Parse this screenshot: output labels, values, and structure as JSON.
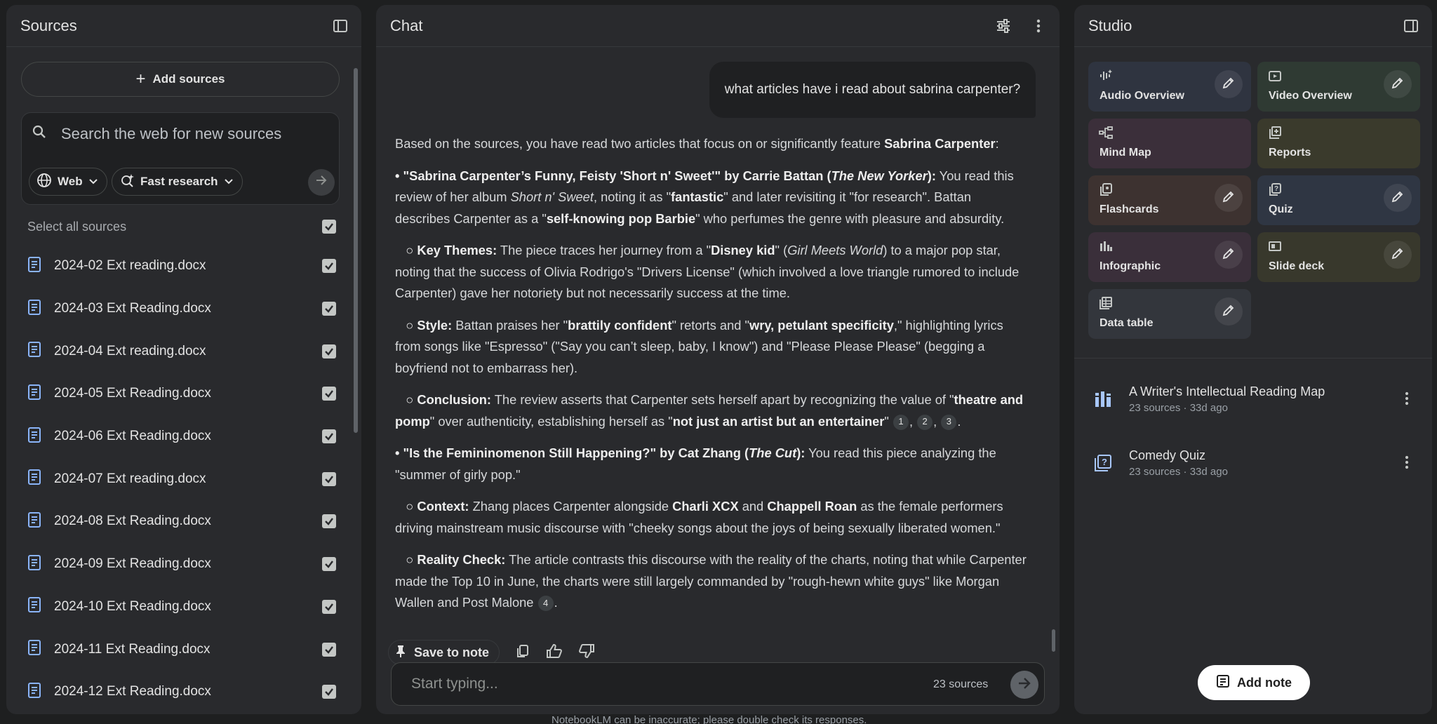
{
  "sources": {
    "title": "Sources",
    "add_sources_label": "Add sources",
    "search_placeholder": "Search the web for new sources",
    "web_chip": "Web",
    "research_chip": "Fast research",
    "select_all_label": "Select all sources",
    "items": [
      {
        "name": "2024-02 Ext reading.docx"
      },
      {
        "name": "2024-03 Ext Reading.docx"
      },
      {
        "name": "2024-04 Ext reading.docx"
      },
      {
        "name": "2024-05 Ext Reading.docx"
      },
      {
        "name": "2024-06 Ext Reading.docx"
      },
      {
        "name": "2024-07 Ext reading.docx"
      },
      {
        "name": "2024-08 Ext Reading.docx"
      },
      {
        "name": "2024-09 Ext Reading.docx"
      },
      {
        "name": "2024-10 Ext Reading.docx"
      },
      {
        "name": "2024-11 Ext Reading.docx"
      },
      {
        "name": "2024-12 Ext Reading.docx"
      }
    ]
  },
  "chat": {
    "title": "Chat",
    "user_message": "what articles have i read about sabrina carpenter?",
    "response": {
      "intro_a": "Based on the sources, you have read two articles that focus on or significantly feature ",
      "intro_b": "Sabrina Carpenter",
      "intro_c": ":",
      "a1_title": "• \"Sabrina Carpenter’s Funny, Feisty 'Short n' Sweet'\" by Carrie Battan (",
      "a1_pub": "The New Yorker",
      "a1_close": "):",
      "a1_t1": " You read this review of her album ",
      "a1_album": "Short n' Sweet",
      "a1_t2": ", noting it as \"",
      "a1_fantastic": "fantastic",
      "a1_t3": "\" and later revisiting it \"for research\". Battan describes Carpenter as a \"",
      "a1_barbie": "self-knowing pop Barbie",
      "a1_t4": "\" who perfumes the genre with pleasure and absurdity.",
      "kt_label": "○ Key Themes:",
      "kt_t1": " The piece traces her journey from a \"",
      "kt_disney": "Disney kid",
      "kt_t2": "\" (",
      "kt_gmw": "Girl Meets World",
      "kt_t3": ") to a major pop star, noting that the success of Olivia Rodrigo's \"Drivers License\" (which involved a love triangle rumored to include Carpenter) gave her notoriety but not necessarily success at the time.",
      "st_label": "○ Style:",
      "st_t1": " Battan praises her \"",
      "st_b1": "brattily confident",
      "st_t2": "\" retorts and \"",
      "st_b2": "wry, petulant specificity",
      "st_t3": ",\" highlighting lyrics from songs like \"Espresso\" (\"Say you can’t sleep, baby, I know\") and \"Please Please Please\" (begging a boyfriend not to embarrass her).",
      "co_label": "○ Conclusion:",
      "co_t1": " The review asserts that Carpenter sets herself apart by recognizing the value of \"",
      "co_b1": "theatre and pomp",
      "co_t2": "\" over authenticity, establishing herself as \"",
      "co_b2": "not just an artist but an entertainer",
      "co_t3": "\"",
      "cites_a": [
        "1",
        "2",
        "3"
      ],
      "a2_title": "• \"Is the Femininomenon Still Happening?\" by Cat Zhang (",
      "a2_pub": "The Cut",
      "a2_close": "):",
      "a2_t1": " You read this piece analyzing the \"summer of girly pop.\"",
      "cx_label": "○ Context:",
      "cx_t1": " Zhang places Carpenter alongside ",
      "cx_b1": "Charli XCX",
      "cx_t2": " and ",
      "cx_b2": "Chappell Roan",
      "cx_t3": " as the female performers driving mainstream music discourse with \"cheeky songs about the joys of being sexually liberated women.\"",
      "rc_label": "○ Reality Check:",
      "rc_t1": " The article contrasts this discourse with the reality of the charts, noting that while Carpenter made the Top 10 in June, the charts were still largely commanded by \"rough-hewn white guys\" like Morgan Wallen and Post Malone",
      "cite_b": "4"
    },
    "save_to_note": "Save to note",
    "input_placeholder": "Start typing...",
    "source_count": "23 sources",
    "disclaimer": "NotebookLM can be inaccurate; please double check its responses."
  },
  "studio": {
    "title": "Studio",
    "tiles": [
      {
        "label": "Audio Overview",
        "bg": "#2f3440",
        "icon": "audio-waveform-icon"
      },
      {
        "label": "Video Overview",
        "bg": "#2f3a33",
        "icon": "video-icon"
      },
      {
        "label": "Mind Map",
        "bg": "#3b2f3a",
        "icon": "mind-map-icon"
      },
      {
        "label": "Reports",
        "bg": "#3a3a2c",
        "icon": "reports-icon"
      },
      {
        "label": "Flashcards",
        "bg": "#3d3230",
        "icon": "flashcards-icon"
      },
      {
        "label": "Quiz",
        "bg": "#2f3643",
        "icon": "quiz-icon"
      },
      {
        "label": "Infographic",
        "bg": "#3a2f3a",
        "icon": "infographic-icon"
      },
      {
        "label": "Slide deck",
        "bg": "#38382c",
        "icon": "slide-deck-icon"
      },
      {
        "label": "Data table",
        "bg": "#33363c",
        "icon": "data-table-icon"
      }
    ],
    "notes": [
      {
        "title": "A Writer's Intellectual Reading Map",
        "meta": "23 sources · 33d ago"
      },
      {
        "title": "Comedy Quiz",
        "meta": "23 sources · 33d ago"
      }
    ],
    "add_note": "Add note"
  }
}
